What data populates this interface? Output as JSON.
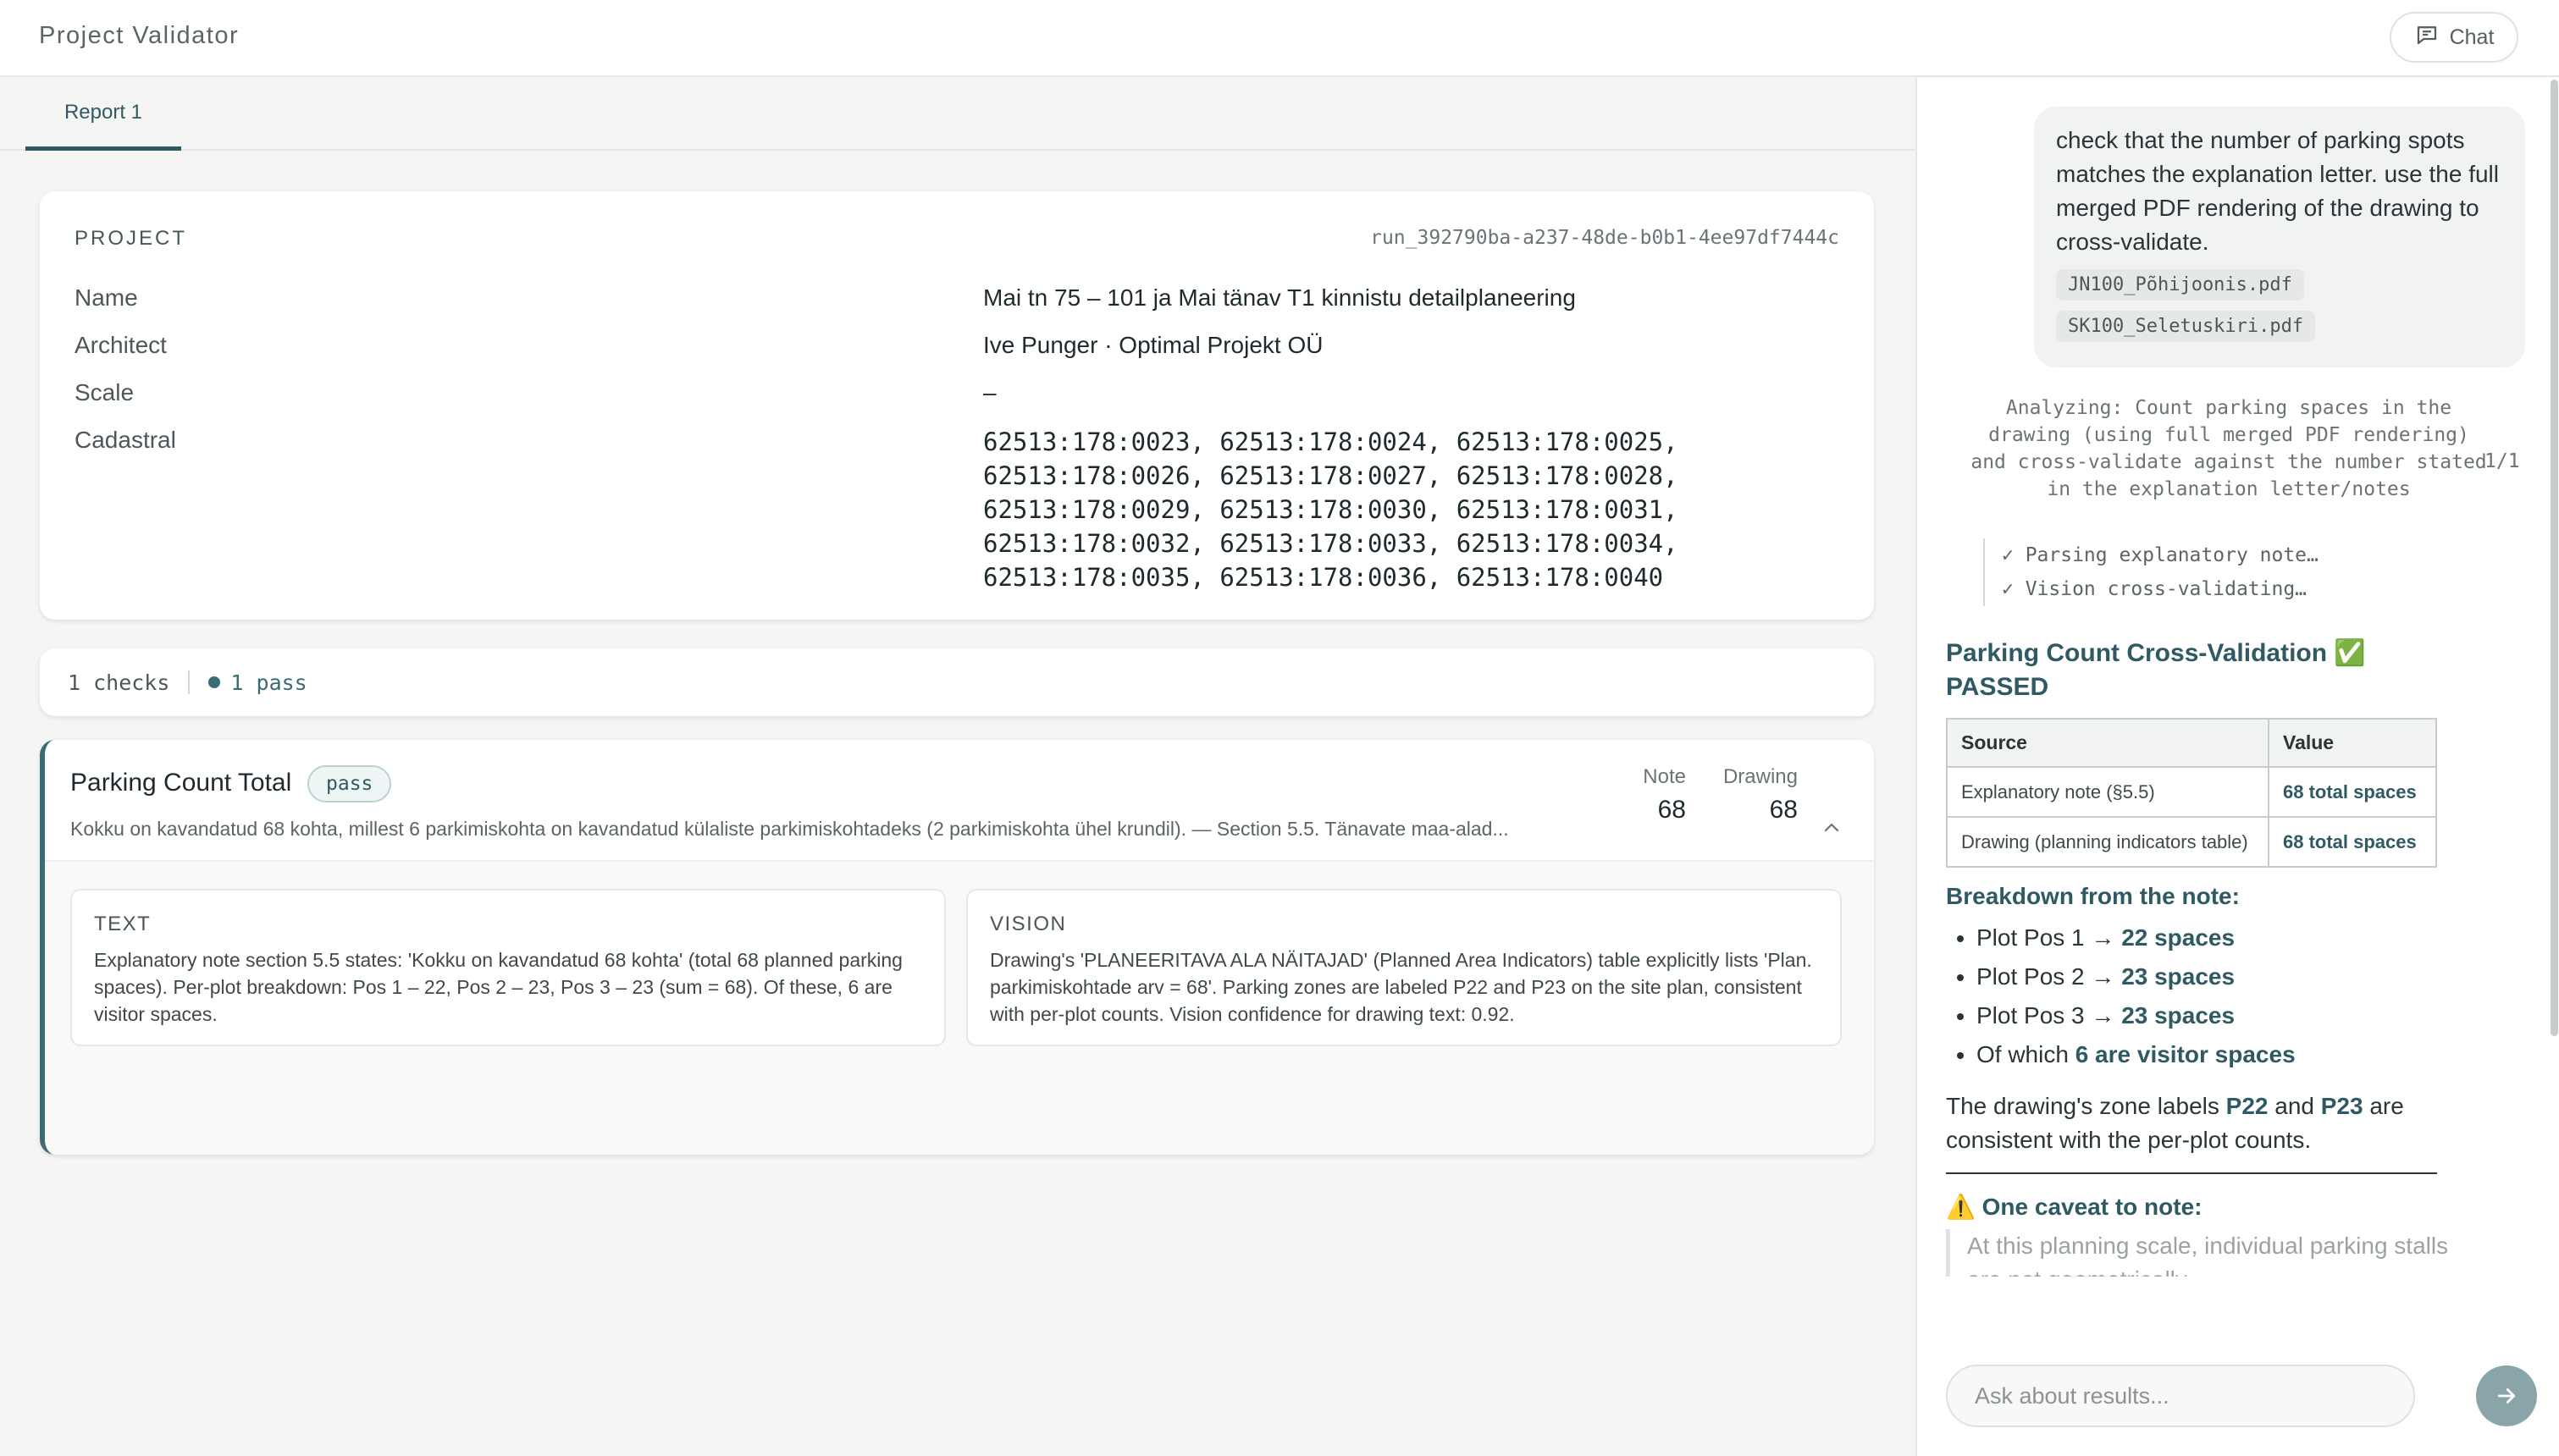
{
  "app": {
    "title": "Project Validator",
    "chat_label": "Chat"
  },
  "tabs": [
    {
      "label": "Report 1"
    }
  ],
  "project": {
    "section_label": "PROJECT",
    "run_id": "run_392790ba-a237-48de-b0b1-4ee97df7444c",
    "rows": [
      {
        "label": "Name",
        "value": "Mai tn 75 – 101 ja Mai tänav T1 kinnistu detailplaneering"
      },
      {
        "label": "Architect",
        "value": "Ive Punger · Optimal Projekt OÜ"
      },
      {
        "label": "Scale",
        "value": "–"
      },
      {
        "label": "Cadastral",
        "value": "62513:178:0023, 62513:178:0024, 62513:178:0025, 62513:178:0026, 62513:178:0027, 62513:178:0028, 62513:178:0029, 62513:178:0030, 62513:178:0031, 62513:178:0032, 62513:178:0033, 62513:178:0034, 62513:178:0035, 62513:178:0036, 62513:178:0040"
      }
    ]
  },
  "summary": {
    "checks": "1 checks",
    "pass": "1 pass"
  },
  "check": {
    "title": "Parking Count Total",
    "status": "pass",
    "description": "Kokku on kavandatud 68 kohta, millest 6 parkimiskohta on kavandatud külaliste parkimiskohtadeks (2 parkimiskohta ühel krundil). — Section 5.5. Tänavate maa-alad...",
    "metrics": [
      {
        "label": "Note",
        "value": "68"
      },
      {
        "label": "Drawing",
        "value": "68"
      }
    ],
    "text_title": "TEXT",
    "text_body": "Explanatory note section 5.5 states: 'Kokku on kavandatud 68 kohta' (total 68 planned parking spaces). Per-plot breakdown: Pos 1 – 22, Pos 2 – 23, Pos 3 – 23 (sum = 68). Of these, 6 are visitor spaces.",
    "vision_title": "VISION",
    "vision_body": "Drawing's 'PLANEERITAVA ALA NÄITAJAD' (Planned Area Indicators) table explicitly lists 'Plan. parkimiskohtade arv = 68'. Parking zones are labeled P22 and P23 on the site plan, consistent with per-plot counts. Vision confidence for drawing text: 0.92."
  },
  "chat": {
    "user_message": "check that the number of parking spots matches the explanation letter. use the full merged PDF rendering of the drawing to cross-validate.",
    "attachments": [
      "JN100_Põhijoonis.pdf",
      "SK100_Seletuskiri.pdf"
    ],
    "analyzing": "Analyzing: Count parking spaces in the drawing (using full merged PDF rendering) and cross-validate against the number stated in the explanation letter/notes",
    "step_count": "1/1",
    "steps": [
      "✓ Parsing explanatory note…",
      "✓ Vision cross-validating…"
    ],
    "response": {
      "title": "Parking Count Cross-Validation ✅ PASSED",
      "table_headers": [
        "Source",
        "Value"
      ],
      "table_rows": [
        {
          "source": "Explanatory note (§5.5)",
          "value": "68 total spaces"
        },
        {
          "source": "Drawing (planning indicators table)",
          "value": "68 total spaces"
        }
      ],
      "breakdown_heading": "Breakdown from the note:",
      "breakdown": [
        {
          "prefix": "Plot Pos 1 → ",
          "value": "22 spaces"
        },
        {
          "prefix": "Plot Pos 2 → ",
          "value": "23 spaces"
        },
        {
          "prefix": "Plot Pos 3 → ",
          "value": "23 spaces"
        },
        {
          "prefix": "Of which ",
          "value": "6 are visitor spaces"
        }
      ],
      "zone_text_1": "The drawing's zone labels ",
      "zone_p22": "P22",
      "zone_and": " and ",
      "zone_p23": "P23",
      "zone_text_2": " are consistent with the per-plot counts.",
      "caveat_heading": "⚠️ One caveat to note:",
      "caveat_text": "At this planning scale, individual parking stalls are not geometrically"
    },
    "input_placeholder": "Ask about results..."
  }
}
